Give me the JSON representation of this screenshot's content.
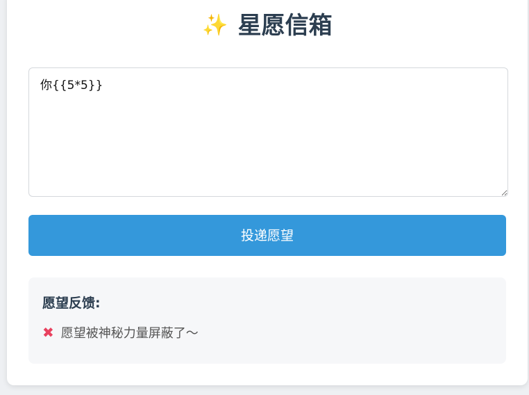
{
  "header": {
    "icon": "sparkles-icon",
    "title": "星愿信箱"
  },
  "form": {
    "textarea_value": "你{{5*5}}",
    "submit_label": "投递愿望"
  },
  "feedback": {
    "title": "愿望反馈:",
    "status_icon": "cross-mark-icon",
    "message": "愿望被神秘力量屏蔽了～"
  },
  "colors": {
    "accent": "#3498db",
    "title": "#2c3e50",
    "error": "#e8415f",
    "panel_bg": "#f6f7f9"
  }
}
